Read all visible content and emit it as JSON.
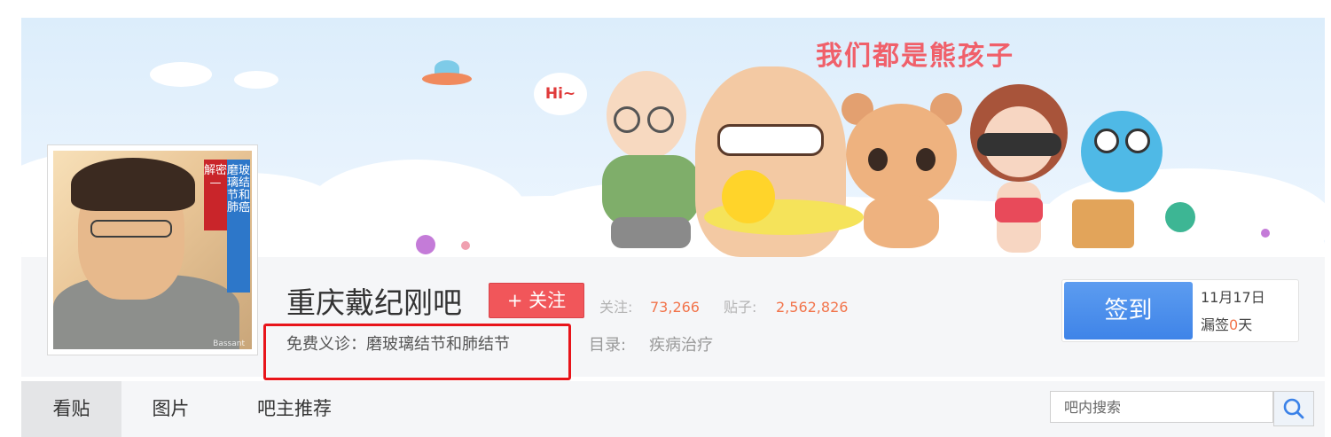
{
  "banner": {
    "slogan_art": "我们都是熊孩子",
    "speech_bubble": "Hi~"
  },
  "avatar": {
    "vertical_text_red": "解密—",
    "vertical_text_blue": "磨玻璃结节和肺癌",
    "bottom_text": "Bassant"
  },
  "forum": {
    "title": "重庆戴纪刚吧",
    "follow_label": "+ 关注",
    "stats": {
      "followers_label": "关注:",
      "followers_value": "73,266",
      "posts_label": "贴子:",
      "posts_value": "2,562,826"
    },
    "slogan": "免费义诊：磨玻璃结节和肺结节",
    "directory_label": "目录:",
    "directory_value": "疾病治疗"
  },
  "sign_in": {
    "button_label": "签到",
    "date": "11月17日",
    "missed_prefix": "漏签",
    "missed_days": "0",
    "missed_suffix": "天"
  },
  "nav": {
    "tabs": [
      {
        "label": "看贴",
        "active": true
      },
      {
        "label": "图片",
        "active": false
      },
      {
        "label": "吧主推荐",
        "active": false
      }
    ]
  },
  "search": {
    "placeholder": "吧内搜索",
    "icon": "search-icon"
  },
  "colors": {
    "accent_blue": "#4a8eea",
    "follow_red": "#f1565a",
    "stat_orange": "#f2744b",
    "highlight_red": "#e8141a"
  }
}
